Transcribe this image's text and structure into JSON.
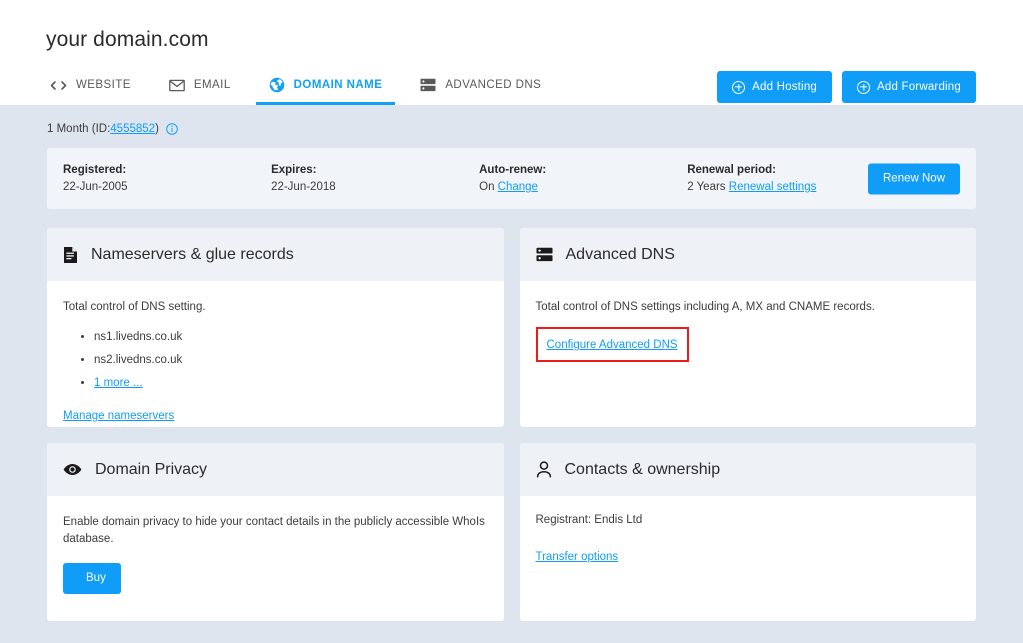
{
  "header": {
    "domain_title": "your domain.com",
    "tabs": [
      {
        "label": "WEBSITE",
        "icon": "code-brackets-icon",
        "active": false
      },
      {
        "label": "EMAIL",
        "icon": "envelope-icon",
        "active": false
      },
      {
        "label": "DOMAIN NAME",
        "icon": "globe-icon",
        "active": true
      },
      {
        "label": "ADVANCED DNS",
        "icon": "server-icon",
        "active": false
      }
    ],
    "actions": [
      {
        "label": "Add Hosting",
        "icon": "plus-circle-icon"
      },
      {
        "label": "Add Forwarding",
        "icon": "plus-circle-icon"
      }
    ]
  },
  "subline": {
    "prefix": "1 Month (ID: ",
    "id": "4555852",
    "suffix": ")",
    "info_icon": "info-circle-icon"
  },
  "renewal": {
    "registered_label": "Registered:",
    "registered_value": "22-Jun-2005",
    "expires_label": "Expires:",
    "expires_value": "22-Jun-2018",
    "autorenew_label": "Auto-renew:",
    "autorenew_value": "On",
    "autorenew_link": "Change",
    "period_label": "Renewal period:",
    "period_value": "2 Years",
    "period_link": "Renewal settings",
    "renew_button": "Renew Now"
  },
  "cards": {
    "nameservers": {
      "title": "Nameservers & glue records",
      "icon": "document-icon",
      "text": "Total control of DNS setting.",
      "items": [
        "ns1.livedns.co.uk",
        "ns2.livedns.co.uk"
      ],
      "more_link": "1 more ...",
      "manage_link": "Manage nameservers"
    },
    "advanced_dns": {
      "title": "Advanced DNS",
      "icon": "server-icon",
      "text": "Total control of DNS settings including A, MX and CNAME records.",
      "configure_link": "Configure Advanced DNS",
      "highlight_color": "#ef1b1b"
    },
    "domain_privacy": {
      "title": "Domain Privacy",
      "icon": "eye-icon",
      "text": "Enable domain privacy to hide your contact details in the publicly accessible WhoIs database.",
      "buy_button": "Buy"
    },
    "contacts": {
      "title": "Contacts & ownership",
      "icon": "person-icon",
      "registrant": "Registrant: Endis Ltd",
      "transfer_link": "Transfer options"
    }
  },
  "colors": {
    "accent": "#0f9df7",
    "page_bg": "#dfe5ee",
    "card_header_bg": "#eef1f6",
    "highlight": "#ef1b1b"
  }
}
